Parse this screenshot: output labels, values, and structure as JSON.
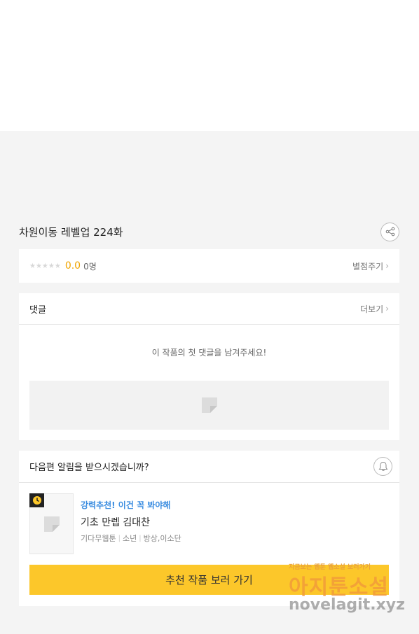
{
  "episode": {
    "title": "차원이동 레벨업 224화"
  },
  "rating": {
    "stars": "★★★★★",
    "score": "0.0",
    "count": "0명",
    "rate_label": "별점주기"
  },
  "comments": {
    "header": "댓글",
    "more_label": "더보기",
    "empty_message": "이 작품의 첫 댓글을 남겨주세요!"
  },
  "alarm": {
    "question": "다음편 알림을 받으시겠습니까?"
  },
  "recommendation": {
    "tag": "강력추천! 이건 꼭 봐야해",
    "title": "기초 만렙 김대찬",
    "meta": [
      "기다무웹툰",
      "소년",
      "방상,이소단"
    ],
    "cta_label": "추천 작품 보러 가기"
  },
  "watermark": {
    "line1": "지금보는 웹툰 웹소설 보러가기",
    "line2": "아지툰소설",
    "line3": "novelagit.xyz"
  },
  "colors": {
    "accent_yellow": "#fcc72a",
    "score_orange": "#f0a500",
    "tag_blue": "#3b8de0",
    "background": "#f4f4f4"
  }
}
